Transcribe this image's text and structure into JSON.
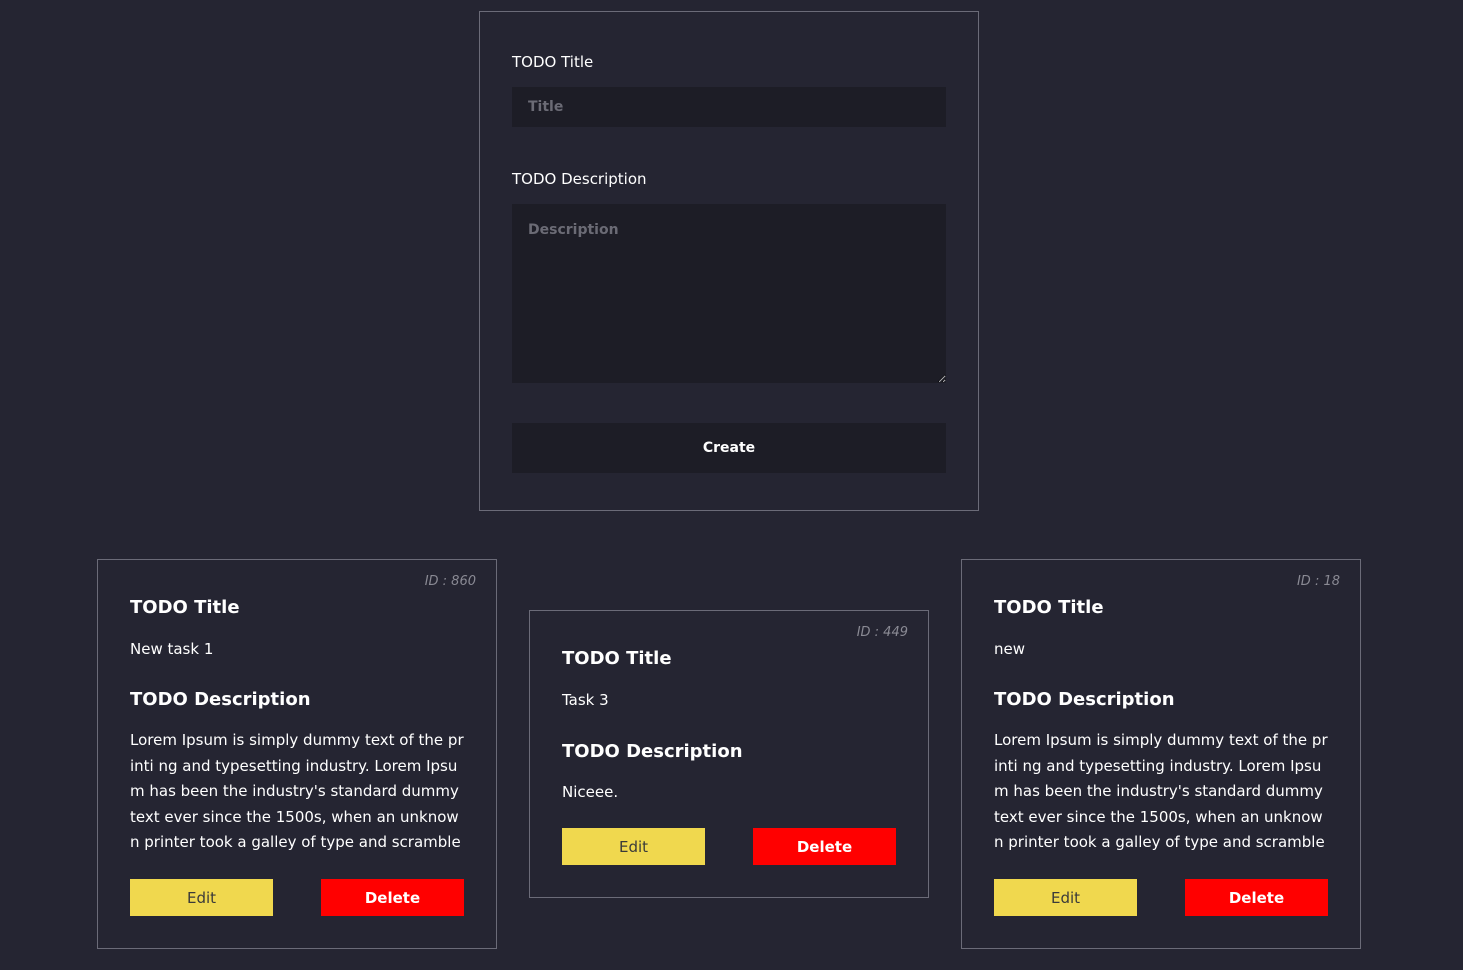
{
  "form": {
    "title_label": "TODO Title",
    "title_placeholder": "Title",
    "title_value": "",
    "description_label": "TODO Description",
    "description_placeholder": "Description",
    "description_value": "",
    "create_label": "Create"
  },
  "todos": [
    {
      "id_label": "ID : 860",
      "title_heading": "TODO Title",
      "title": "New task 1",
      "description_heading": "TODO Description",
      "description": "Lorem Ipsum is simply dummy text of the printi ng and typesetting industry. Lorem Ipsum has been the industry's standard dummy text ever since the 1500s, when an unknown printer took a galley of type and scrambled it to make a ty...",
      "edit_label": "Edit",
      "delete_label": "Delete"
    },
    {
      "id_label": "ID : 449",
      "title_heading": "TODO Title",
      "title": "Task 3",
      "description_heading": "TODO Description",
      "description": "Niceee.",
      "edit_label": "Edit",
      "delete_label": "Delete"
    },
    {
      "id_label": "ID : 18",
      "title_heading": "TODO Title",
      "title": "new",
      "description_heading": "TODO Description",
      "description": "Lorem Ipsum is simply dummy text of the printi ng and typesetting industry. Lorem Ipsum has been the industry's standard dummy text ever since the 1500s, when an unknown printer took a galley of type and scrambled it to make a ty...",
      "edit_label": "Edit",
      "delete_label": "Delete"
    }
  ],
  "colors": {
    "background": "#252532",
    "input_background": "#1d1d26",
    "border": "#6b6b78",
    "edit_button": "#f0d84e",
    "delete_button": "#ff0000"
  }
}
